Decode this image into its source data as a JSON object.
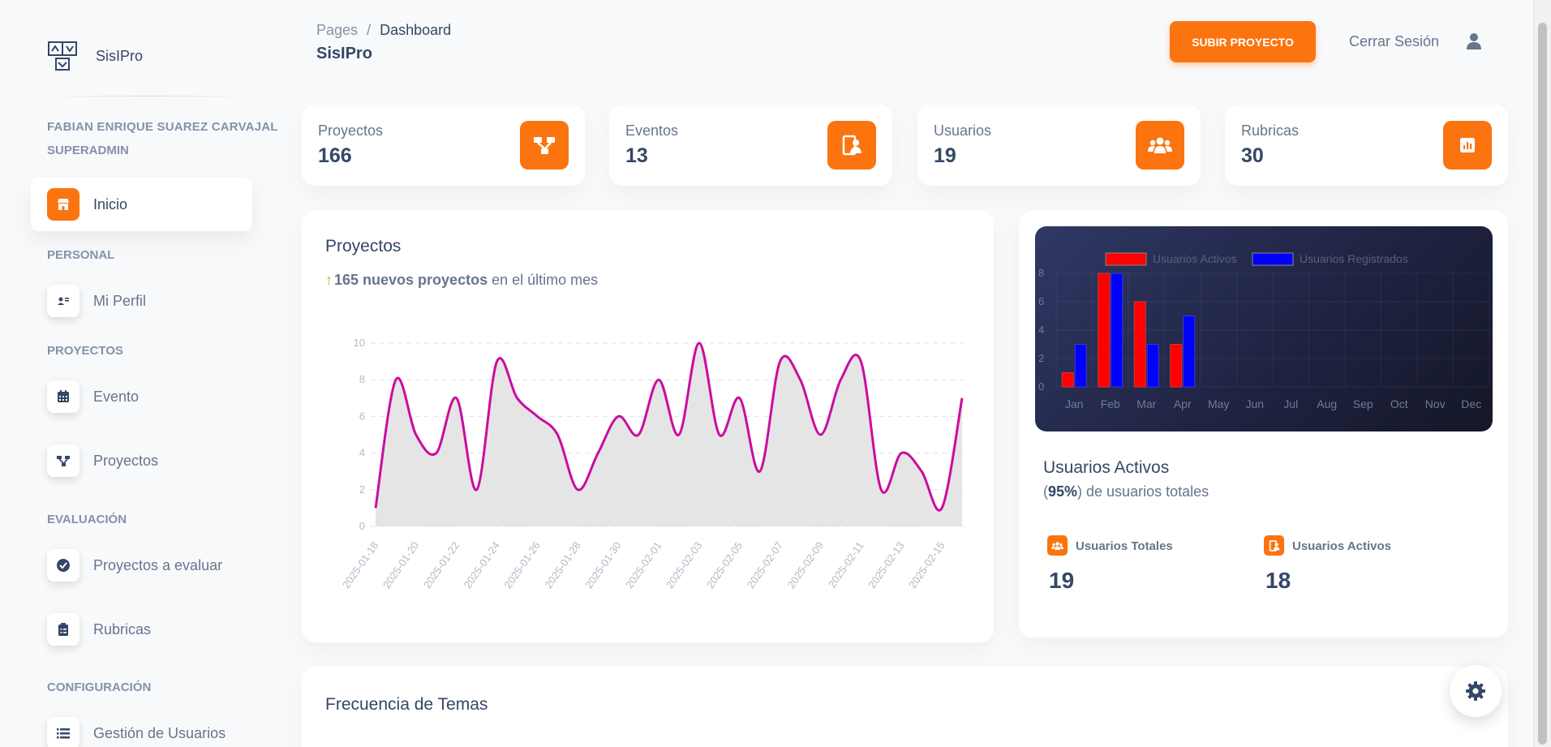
{
  "sidebar": {
    "brand": "SisIPro",
    "user_name": "FABIAN ENRIQUE SUAREZ CARVAJAL",
    "user_role": "SUPERADMIN",
    "inicio": "Inicio",
    "sections": {
      "personal": "PERSONAL",
      "proyectos": "PROYECTOS",
      "evaluacion": "EVALUACIÓN",
      "configuracion": "CONFIGURACIÓN"
    },
    "items": {
      "mi_perfil": "Mi Perfil",
      "evento": "Evento",
      "proyectos": "Proyectos",
      "proyectos_evaluar": "Proyectos a evaluar",
      "rubricas": "Rubricas",
      "gestion_usuarios": "Gestión de Usuarios"
    }
  },
  "header": {
    "breadcrumb_root": "Pages",
    "breadcrumb_sep": "/",
    "breadcrumb_current": "Dashboard",
    "title": "SisIPro",
    "upload_button": "SUBIR PROYECTO",
    "logout": "Cerrar Sesión"
  },
  "stats": [
    {
      "label": "Proyectos",
      "value": "166"
    },
    {
      "label": "Eventos",
      "value": "13"
    },
    {
      "label": "Usuarios",
      "value": "19"
    },
    {
      "label": "Rubricas",
      "value": "30"
    }
  ],
  "projects_card": {
    "title": "Proyectos",
    "highlight": "165 nuevos proyectos",
    "rest": "en el último mes"
  },
  "users_card": {
    "title": "Usuarios Activos",
    "sub_open": "(",
    "percent": "95%",
    "sub_close": ") de usuarios totales",
    "total_label": "Usuarios Totales",
    "total_value": "19",
    "active_label": "Usuarios Activos",
    "active_value": "18"
  },
  "freq_card": {
    "title": "Frecuencia de Temas"
  },
  "colors": {
    "accent": "#fb7410",
    "line": "#cb0c9f",
    "bar_active": "#ff0000",
    "bar_registered": "#0000ff"
  },
  "chart_data": [
    {
      "type": "area",
      "x": [
        "2025-01-18",
        "2025-01-19",
        "2025-01-20",
        "2025-01-21",
        "2025-01-22",
        "2025-01-23",
        "2025-01-24",
        "2025-01-25",
        "2025-01-26",
        "2025-01-27",
        "2025-01-28",
        "2025-01-29",
        "2025-01-30",
        "2025-01-31",
        "2025-02-01",
        "2025-02-02",
        "2025-02-03",
        "2025-02-04",
        "2025-02-05",
        "2025-02-06",
        "2025-02-07",
        "2025-02-08",
        "2025-02-09",
        "2025-02-10",
        "2025-02-11",
        "2025-02-12",
        "2025-02-13",
        "2025-02-14",
        "2025-02-15",
        "2025-02-16"
      ],
      "tick_labels": [
        "2025-01-18",
        "2025-01-20",
        "2025-01-22",
        "2025-01-24",
        "2025-01-26",
        "2025-01-28",
        "2025-01-30",
        "2025-02-01",
        "2025-02-03",
        "2025-02-05",
        "2025-02-07",
        "2025-02-09",
        "2025-02-11",
        "2025-02-13",
        "2025-02-15"
      ],
      "values": [
        1,
        8,
        5,
        4,
        7,
        2,
        9,
        7,
        6,
        5,
        2,
        4,
        6,
        5,
        8,
        5,
        10,
        5,
        7,
        3,
        9,
        8,
        5,
        8,
        9,
        2,
        4,
        3,
        1,
        7
      ],
      "yticks": [
        0,
        2,
        4,
        6,
        8,
        10
      ],
      "ylim": [
        0,
        10
      ],
      "grid": true
    },
    {
      "type": "bar",
      "categories": [
        "Jan",
        "Feb",
        "Mar",
        "Apr",
        "May",
        "Jun",
        "Jul",
        "Aug",
        "Sep",
        "Oct",
        "Nov",
        "Dec"
      ],
      "series": [
        {
          "name": "Usuarios Activos",
          "values": [
            1,
            8,
            6,
            3,
            null,
            null,
            null,
            null,
            null,
            null,
            null,
            null
          ]
        },
        {
          "name": "Usuarios Registrados",
          "values": [
            3,
            8,
            3,
            5,
            null,
            null,
            null,
            null,
            null,
            null,
            null,
            null
          ]
        }
      ],
      "yticks": [
        0,
        2,
        4,
        6,
        8
      ],
      "ylim": [
        0,
        8
      ],
      "legend": "top",
      "grid": true
    }
  ]
}
